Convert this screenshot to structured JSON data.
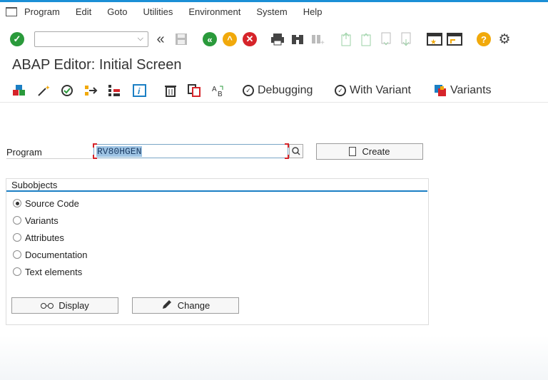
{
  "menu": {
    "items": [
      {
        "label": "Program"
      },
      {
        "label": "Edit"
      },
      {
        "label": "Goto"
      },
      {
        "label": "Utilities"
      },
      {
        "label": "Environment"
      },
      {
        "label": "System"
      },
      {
        "label": "Help"
      }
    ]
  },
  "toolbar": {
    "command_field_value": "",
    "icons": [
      "enter-icon",
      "back-double-icon",
      "save-icon",
      "back-icon",
      "exit-icon",
      "cancel-icon",
      "print-icon",
      "find-icon",
      "find-next-icon",
      "first-page-icon",
      "previous-page-icon",
      "next-page-icon",
      "last-page-icon",
      "new-session-icon",
      "create-shortcut-icon",
      "help-icon",
      "customize-icon"
    ]
  },
  "page": {
    "title": "ABAP Editor: Initial Screen"
  },
  "app_toolbar": {
    "icons": [
      "object-list-icon",
      "wand-icon",
      "check-icon",
      "activate-icon",
      "where-used-icon",
      "info-icon",
      "delete-icon",
      "copy-icon",
      "rename-icon"
    ],
    "debugging_label": "Debugging",
    "with_variant_label": "With Variant",
    "variants_label": "Variants"
  },
  "program": {
    "label": "Program",
    "value": "RV80HGEN",
    "create_label": "Create"
  },
  "subobjects": {
    "title": "Subobjects",
    "options": [
      {
        "label": "Source Code",
        "selected": true
      },
      {
        "label": "Variants",
        "selected": false
      },
      {
        "label": "Attributes",
        "selected": false
      },
      {
        "label": "Documentation",
        "selected": false
      },
      {
        "label": "Text elements",
        "selected": false
      }
    ],
    "display_label": "Display",
    "change_label": "Change"
  },
  "colors": {
    "accent": "#1b8fd6",
    "green": "#2a9a3b",
    "amber": "#f1a90b",
    "red": "#d6242a"
  }
}
